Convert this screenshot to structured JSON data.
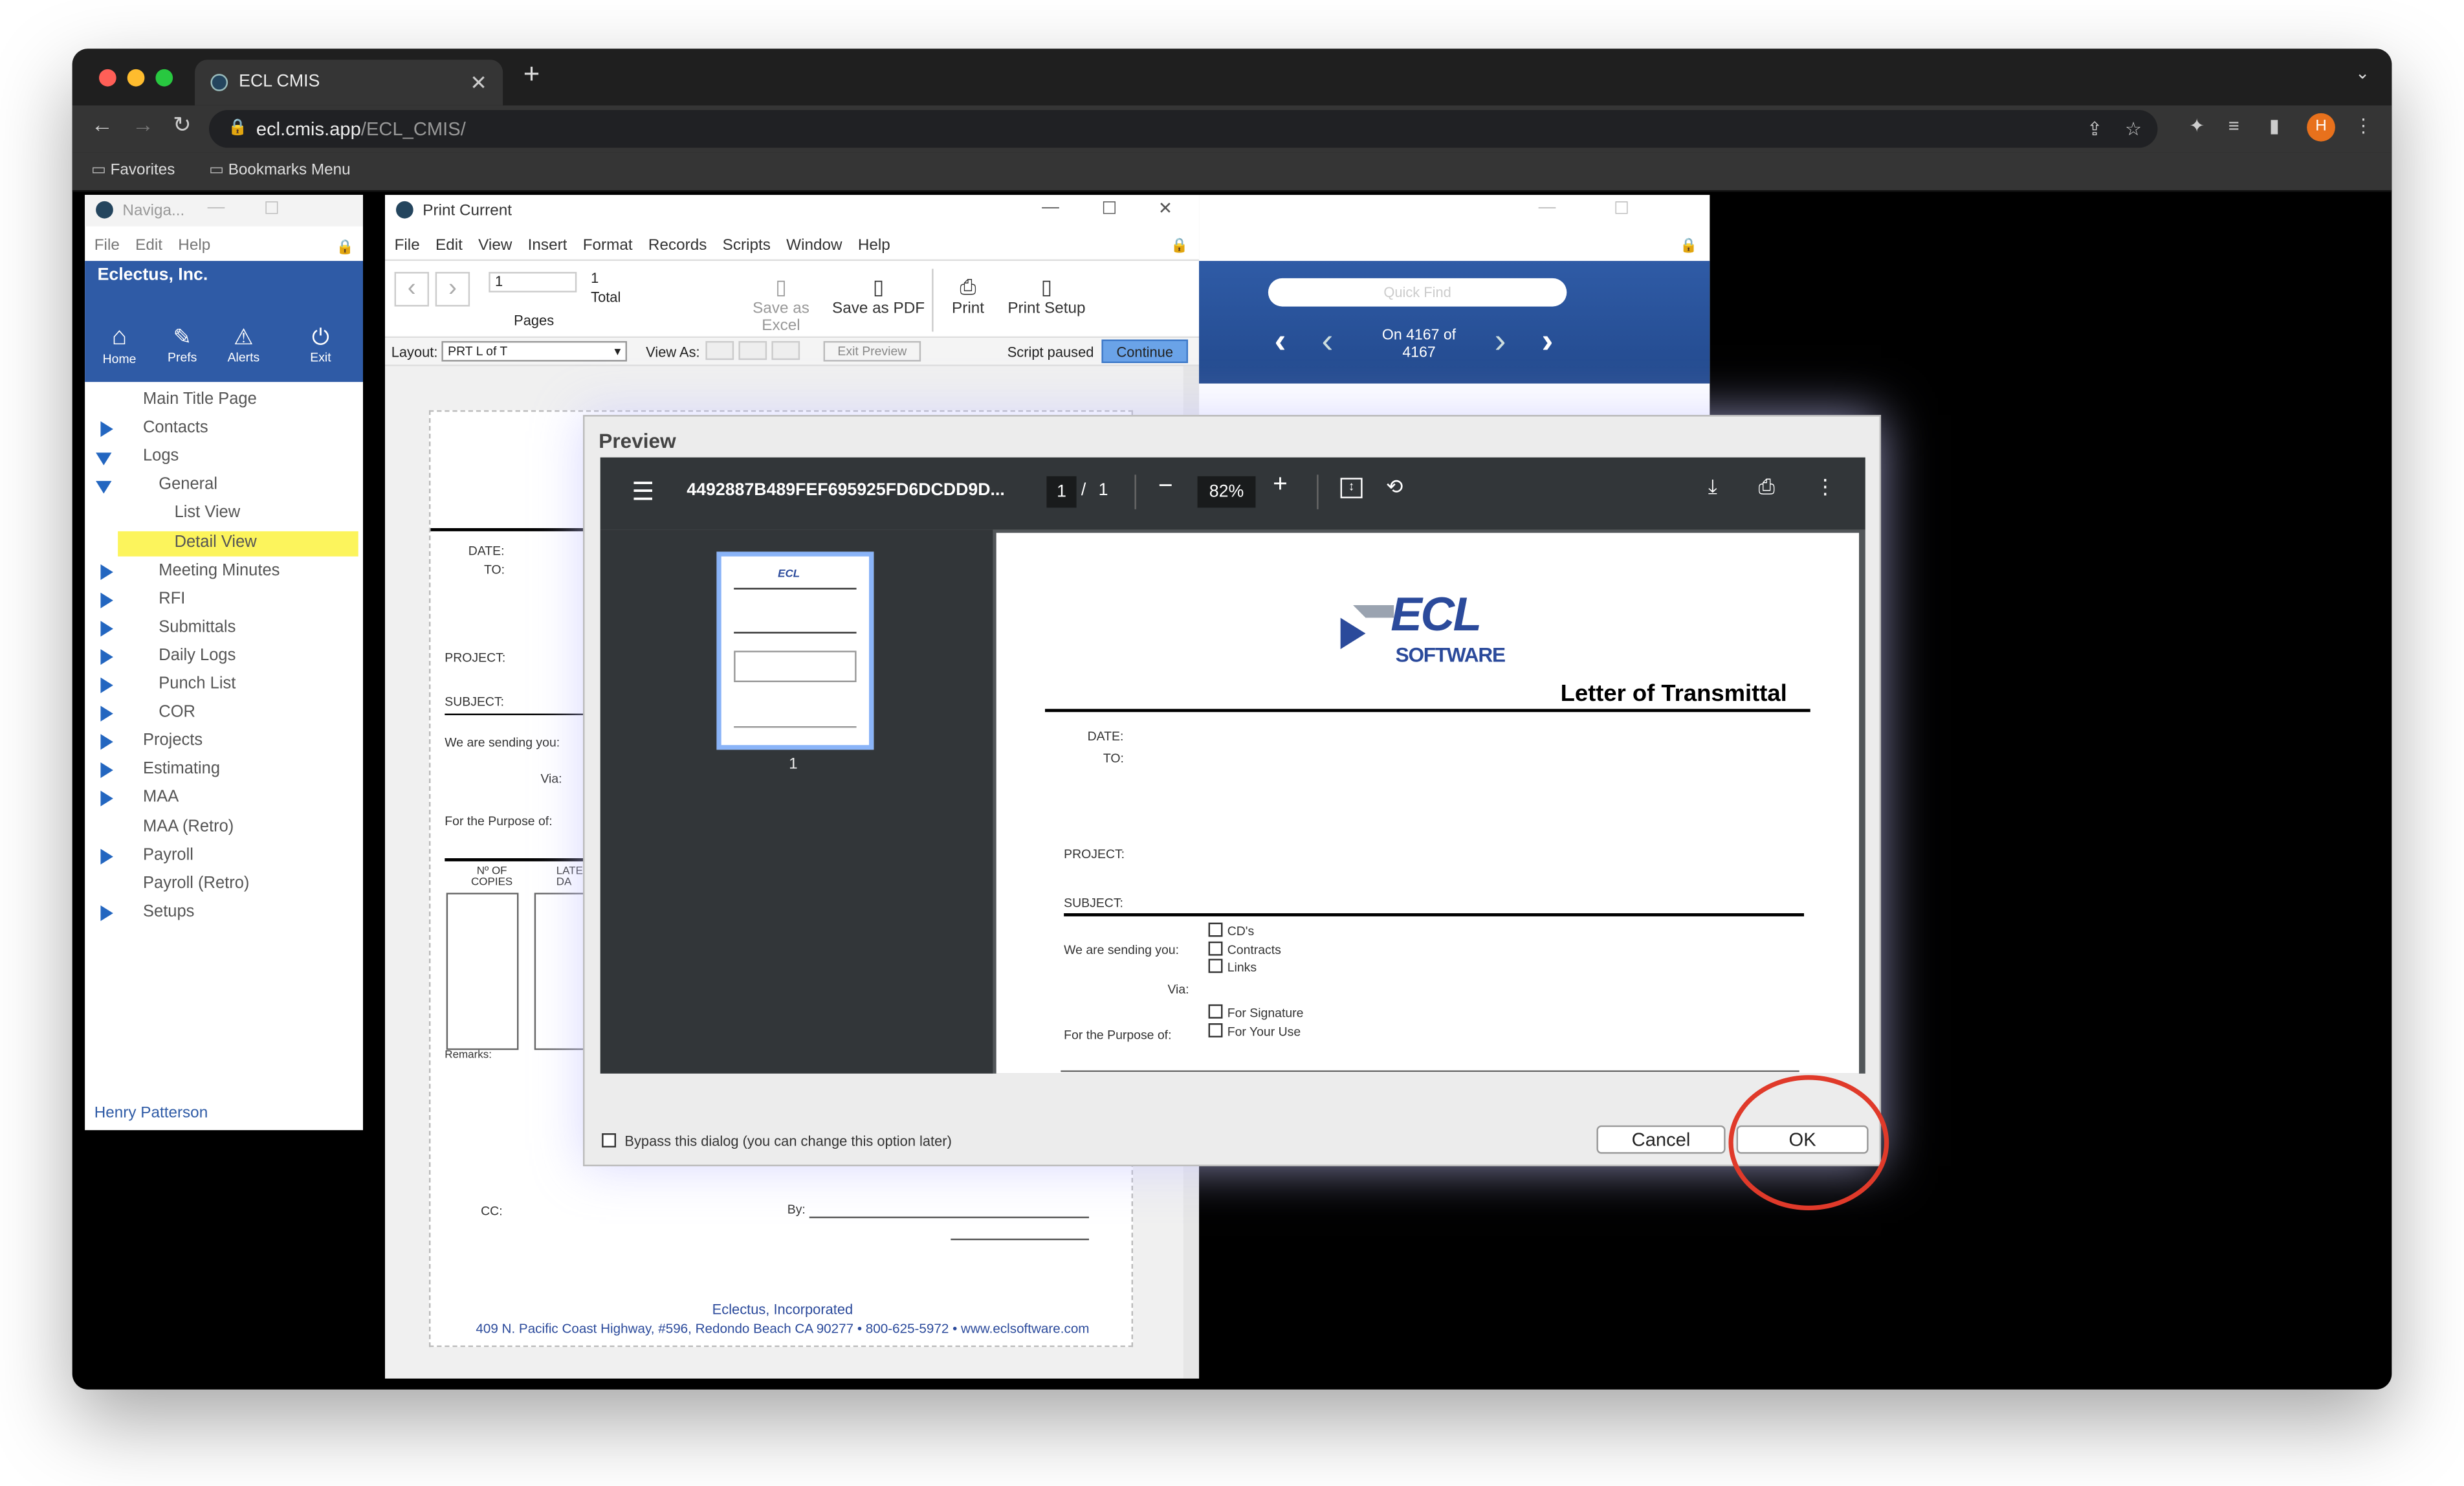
{
  "browser": {
    "tab_title": "ECL CMIS",
    "address_domain": "ecl.cmis.app",
    "address_path": "/ECL_CMIS/",
    "bookmarks": [
      "Favorites",
      "Bookmarks Menu"
    ],
    "profile_initial": "H",
    "colors": {
      "frame": "#1f1f1f",
      "toolbar": "#353535",
      "profile": "#e8711c"
    }
  },
  "navigator": {
    "title": "Naviga...",
    "menu": [
      "File",
      "Edit",
      "Help"
    ],
    "company": "Eclectus, Inc.",
    "header_buttons": [
      "Home",
      "Prefs",
      "Alerts",
      "Exit"
    ],
    "tree": [
      {
        "label": "Main Title Page",
        "indent": 0,
        "arrow": "none"
      },
      {
        "label": "Contacts",
        "indent": 0,
        "arrow": "right"
      },
      {
        "label": "Logs",
        "indent": 0,
        "arrow": "down"
      },
      {
        "label": "General",
        "indent": 1,
        "arrow": "down"
      },
      {
        "label": "List View",
        "indent": 2,
        "arrow": "none"
      },
      {
        "label": "Detail View",
        "indent": 2,
        "arrow": "none",
        "selected": true
      },
      {
        "label": "Meeting Minutes",
        "indent": 1,
        "arrow": "right"
      },
      {
        "label": "RFI",
        "indent": 1,
        "arrow": "right"
      },
      {
        "label": "Submittals",
        "indent": 1,
        "arrow": "right"
      },
      {
        "label": "Daily Logs",
        "indent": 1,
        "arrow": "right"
      },
      {
        "label": "Punch List",
        "indent": 1,
        "arrow": "right"
      },
      {
        "label": "COR",
        "indent": 1,
        "arrow": "right"
      },
      {
        "label": "Projects",
        "indent": 0,
        "arrow": "right"
      },
      {
        "label": "Estimating",
        "indent": 0,
        "arrow": "right"
      },
      {
        "label": "MAA",
        "indent": 0,
        "arrow": "right"
      },
      {
        "label": "MAA (Retro)",
        "indent": 0,
        "arrow": "none"
      },
      {
        "label": "Payroll",
        "indent": 0,
        "arrow": "right"
      },
      {
        "label": "Payroll (Retro)",
        "indent": 0,
        "arrow": "none"
      },
      {
        "label": "Setups",
        "indent": 0,
        "arrow": "right"
      }
    ],
    "user": "Henry Patterson",
    "colors": {
      "header": "#2f5ba6",
      "selected": "#fcf45c"
    }
  },
  "print_window": {
    "title": "Print Current",
    "menu": [
      "File",
      "Edit",
      "View",
      "Insert",
      "Format",
      "Records",
      "Scripts",
      "Window",
      "Help"
    ],
    "page_input": "1",
    "page_total": "1",
    "total_label": "Total",
    "pages_label": "Pages",
    "toolbar": [
      "Save as Excel",
      "Save as PDF",
      "Print",
      "Print Setup"
    ],
    "layout_label": "Layout:",
    "layout_value": "PRT L of T",
    "view_as_label": "View As:",
    "exit_preview": "Exit Preview",
    "script_paused": "Script paused",
    "continue": "Continue",
    "doc": {
      "date": "DATE:",
      "to": "TO:",
      "project": "PROJECT:",
      "subject": "SUBJECT:",
      "sending": "We are sending you:",
      "via": "Via:",
      "purpose": "For the Purpose of:",
      "copies": "Nº OF COPIES",
      "latest": "LATE DA",
      "remarks": "Remarks:",
      "cc": "CC:",
      "by": "By:",
      "footer_company": "Eclectus, Incorporated",
      "footer_address": "409 N. Pacific Coast Highway, #596, Redondo Beach CA 90277 • 800-625-5972 • www.eclsoftware.com"
    }
  },
  "right_window": {
    "quick_find": "Quick Find",
    "record_line1": "On 4167 of",
    "record_line2": "4167"
  },
  "dialog": {
    "title": "Preview",
    "pdf_name": "4492887B489FEF695925FD6DCDD9D...",
    "page_current": "1",
    "page_sep": "/",
    "page_total": "1",
    "zoom": "82%",
    "thumb_label": "1",
    "page": {
      "logo_ecl": "ECL",
      "logo_software": "SOFTWARE",
      "heading": "Letter of Transmittal",
      "date": "DATE:",
      "to": "TO:",
      "project": "PROJECT:",
      "subject": "SUBJECT:",
      "sending": "We are sending you:",
      "via": "Via:",
      "purpose": "For the Purpose of:",
      "sending_options": [
        "CD's",
        "Contracts",
        "Links"
      ],
      "purpose_options": [
        "For Signature",
        "For Your Use"
      ]
    },
    "bypass": "Bypass this dialog (you can change this option later)",
    "cancel": "Cancel",
    "ok": "OK",
    "colors": {
      "pdf_toolbar": "#323639",
      "highlight_ring": "#e03a2a",
      "logo_blue": "#2b4a9b"
    }
  }
}
